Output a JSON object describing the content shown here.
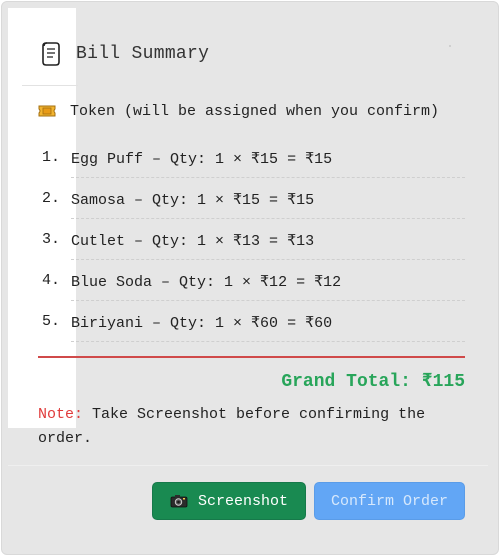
{
  "bill": {
    "title": "Bill Summary",
    "token_text": "Token (will be assigned when you confirm)",
    "items": [
      {
        "num": "1.",
        "text": "Egg Puff – Qty: 1 × ₹15 = ₹15"
      },
      {
        "num": "2.",
        "text": "Samosa – Qty: 1 × ₹15 = ₹15"
      },
      {
        "num": "3.",
        "text": "Cutlet – Qty: 1 × ₹13 = ₹13"
      },
      {
        "num": "4.",
        "text": "Blue Soda – Qty: 1 × ₹12 = ₹12"
      },
      {
        "num": "5.",
        "text": "Biriyani – Qty: 1 × ₹60 = ₹60"
      }
    ],
    "grand_total": "Grand Total: ₹115",
    "note_label": "Note:",
    "note_text": " Take Screenshot before confirming the order."
  },
  "actions": {
    "screenshot_label": "Screenshot",
    "confirm_label": "Confirm Order"
  },
  "colors": {
    "card_background": "#e6e6e6",
    "total_green": "#28a55a",
    "note_red": "#e03b3b",
    "rule_red": "#d04a4a",
    "screenshot_button": "#198a51",
    "confirm_button_disabled": "#62a6f5"
  },
  "icons": {
    "title": "scroll-icon",
    "token": "ticket-icon",
    "screenshot": "camera-icon"
  }
}
